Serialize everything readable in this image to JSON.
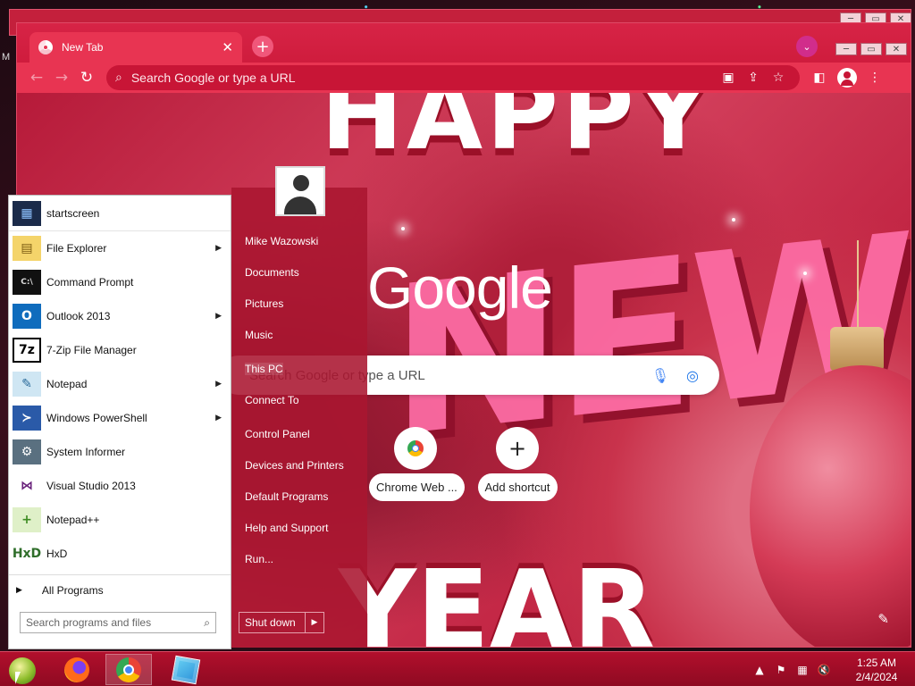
{
  "desktop": {
    "edge_letter": "M"
  },
  "chrome": {
    "tab": {
      "title": "New Tab",
      "close": "✕"
    },
    "new_tab": "+",
    "tab_search": "⌄",
    "toolbar": {
      "back": "←",
      "forward": "→",
      "reload": "↻",
      "omnibox_placeholder": "Search Google or type a URL",
      "icons": [
        "site-blocked-icon",
        "share-icon",
        "star-icon",
        "side-panel-icon",
        "profile-icon",
        "menu-icon"
      ]
    },
    "ntp": {
      "logo": "Google",
      "search_placeholder": "Search Google or type a URL",
      "shortcuts": [
        {
          "label": "Chrome Web ...",
          "icon": "chrome-web-store-icon"
        },
        {
          "label": "Add shortcut",
          "icon": "plus-icon",
          "glyph": "+"
        }
      ],
      "customize_icon": "✎"
    }
  },
  "start_menu": {
    "pinned": [
      {
        "name": "startscreen",
        "icon": "startscreen-icon"
      }
    ],
    "programs": [
      {
        "name": "File Explorer",
        "icon": "file-explorer-icon",
        "submenu": true
      },
      {
        "name": "Command Prompt",
        "icon": "command-prompt-icon",
        "submenu": false
      },
      {
        "name": "Outlook 2013",
        "icon": "outlook-icon",
        "submenu": true
      },
      {
        "name": "7-Zip File Manager",
        "icon": "7zip-icon",
        "submenu": false
      },
      {
        "name": "Notepad",
        "icon": "notepad-icon",
        "submenu": true
      },
      {
        "name": "Windows PowerShell",
        "icon": "powershell-icon",
        "submenu": true
      },
      {
        "name": "System Informer",
        "icon": "system-informer-icon",
        "submenu": false
      },
      {
        "name": "Visual Studio 2013",
        "icon": "visual-studio-icon",
        "submenu": false
      },
      {
        "name": "Notepad++",
        "icon": "notepad-plus-plus-icon",
        "submenu": false
      },
      {
        "name": "HxD",
        "icon": "hxd-icon",
        "submenu": false
      }
    ],
    "all_programs": "All Programs",
    "search_placeholder": "Search programs and files",
    "right_items": [
      "Mike Wazowski",
      "Documents",
      "Pictures",
      "Music",
      "This PC",
      "Connect To",
      "Control Panel",
      "Devices and Printers",
      "Default Programs",
      "Help and Support",
      "Run..."
    ],
    "highlighted_item": "This PC",
    "shutdown_label": "Shut down"
  },
  "taskbar": {
    "apps": [
      "firefox-icon",
      "chrome-icon",
      "puzzle-app-icon"
    ],
    "active_app": "chrome-icon",
    "tray_icons": [
      "show-hidden-icons-icon",
      "flag-icon",
      "network-icon",
      "volume-muted-icon"
    ],
    "time": "1:25 AM",
    "date": "2/4/2024"
  },
  "colors": {
    "tabstrip": "#d72446",
    "toolbar": "#e83452",
    "start_right_panel": "#aa1630",
    "taskbar": "#a00d27"
  }
}
